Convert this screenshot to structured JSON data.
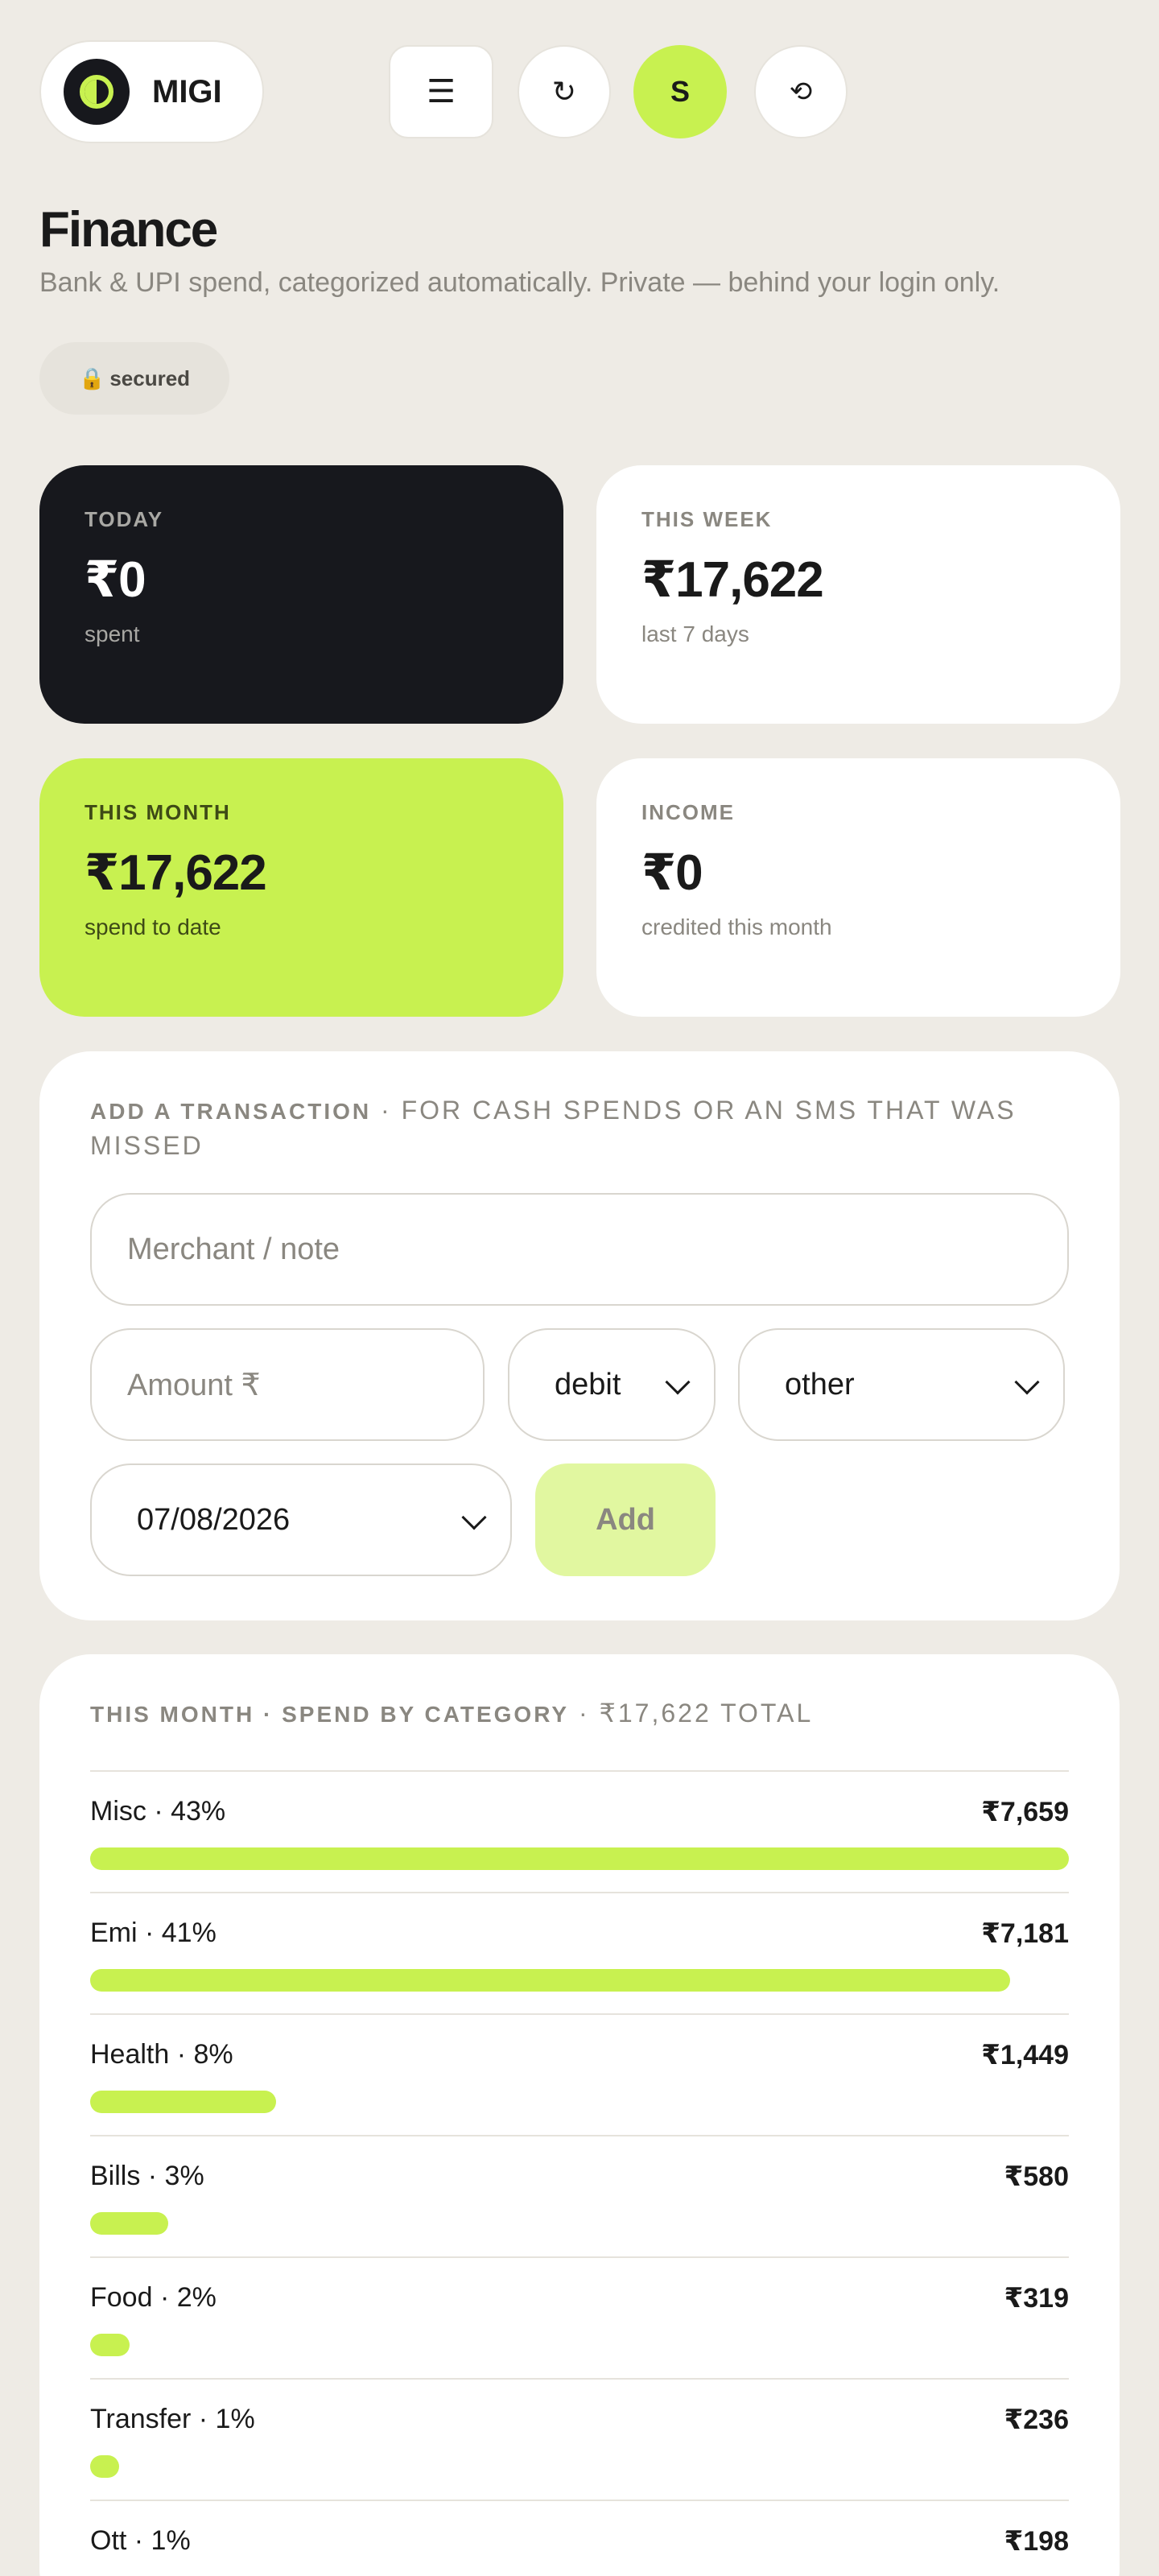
{
  "app": {
    "logo_text": "MIGI",
    "nav": {
      "menu_icon": "☰",
      "refresh_icon": "↻",
      "avatar_initial": "S",
      "history_icon": "⟲"
    }
  },
  "header": {
    "title": "Finance",
    "subtitle": "Bank & UPI spend, categorized automatically. Private — behind your login only.",
    "badge_icon": "🔒",
    "badge_label": "secured"
  },
  "stats": {
    "today": {
      "label": "TODAY",
      "value": "₹0",
      "sub": "spent"
    },
    "week": {
      "label": "THIS WEEK",
      "value": "₹17,622",
      "sub": "last 7 days"
    },
    "month": {
      "label": "THIS MONTH",
      "value": "₹17,622",
      "sub": "spend to date"
    },
    "income": {
      "label": "INCOME",
      "value": "₹0",
      "sub": "credited this month"
    }
  },
  "add_transaction": {
    "heading": "ADD A TRANSACTION",
    "heading_note": " · FOR CASH SPENDS OR AN SMS THAT WAS MISSED",
    "merchant_placeholder": "Merchant / note",
    "amount_placeholder": "Amount ₹",
    "type_value": "debit",
    "category_value": "other",
    "date_value": "07/08/2026",
    "add_label": "Add"
  },
  "spend_by_category": {
    "heading": "THIS MONTH · SPEND BY CATEGORY",
    "total_note": " · ₹17,622 TOTAL",
    "items": [
      {
        "label": "Misc · 43%",
        "amount": "₹7,659",
        "fill": 1.0
      },
      {
        "label": "Emi · 41%",
        "amount": "₹7,181",
        "fill": 0.94
      },
      {
        "label": "Health · 8%",
        "amount": "₹1,449",
        "fill": 0.19
      },
      {
        "label": "Bills · 3%",
        "amount": "₹580",
        "fill": 0.08
      },
      {
        "label": "Food · 2%",
        "amount": "₹319",
        "fill": 0.04
      },
      {
        "label": "Transfer · 1%",
        "amount": "₹236",
        "fill": 0.03
      },
      {
        "label": "Ott · 1%",
        "amount": "₹198",
        "fill": 0.026
      }
    ]
  },
  "colors": {
    "accent": "#c8f150",
    "dark_card": "#17181d",
    "background": "#eeebe5"
  }
}
